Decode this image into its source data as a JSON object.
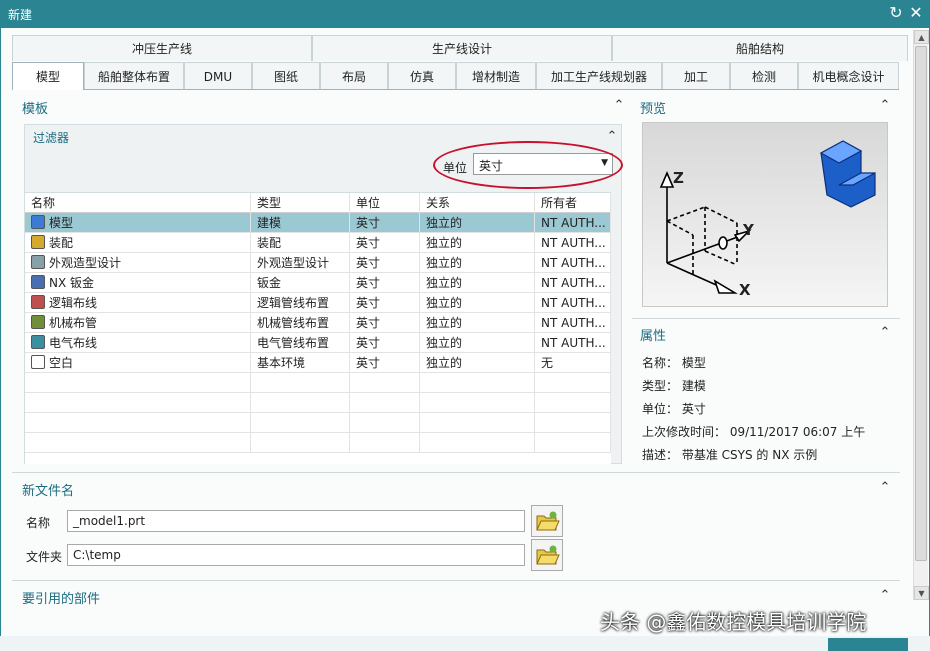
{
  "window": {
    "title": "新建"
  },
  "tabs_row1": [
    "冲压生产线",
    "生产线设计",
    "船舶结构"
  ],
  "tabs_row2": [
    "模型",
    "船舶整体布置",
    "DMU",
    "图纸",
    "布局",
    "仿真",
    "增材制造",
    "加工生产线规划器",
    "加工",
    "检测",
    "机电概念设计"
  ],
  "active_tab": "模型",
  "template_section": {
    "title": "模板"
  },
  "filter": {
    "title": "过滤器",
    "unit_label": "单位",
    "unit_value": "英寸"
  },
  "table": {
    "headers": [
      "名称",
      "类型",
      "单位",
      "关系",
      "所有者"
    ],
    "rows": [
      {
        "name": "模型",
        "type": "建模",
        "unit": "英寸",
        "relation": "独立的",
        "owner": "NT AUTH...",
        "icon": "model-icon",
        "icon_color": "#3a7bd5"
      },
      {
        "name": "装配",
        "type": "装配",
        "unit": "英寸",
        "relation": "独立的",
        "owner": "NT AUTH...",
        "icon": "assembly-icon",
        "icon_color": "#d5a92b"
      },
      {
        "name": "外观造型设计",
        "type": "外观造型设计",
        "unit": "英寸",
        "relation": "独立的",
        "owner": "NT AUTH...",
        "icon": "shape-design-icon",
        "icon_color": "#8aa0a8"
      },
      {
        "name": "NX 钣金",
        "type": "钣金",
        "unit": "英寸",
        "relation": "独立的",
        "owner": "NT AUTH...",
        "icon": "sheet-metal-icon",
        "icon_color": "#4a6fb0"
      },
      {
        "name": "逻辑布线",
        "type": "逻辑管线布置",
        "unit": "英寸",
        "relation": "独立的",
        "owner": "NT AUTH...",
        "icon": "logical-routing-icon",
        "icon_color": "#c0504d"
      },
      {
        "name": "机械布管",
        "type": "机械管线布置",
        "unit": "英寸",
        "relation": "独立的",
        "owner": "NT AUTH...",
        "icon": "mechanical-routing-icon",
        "icon_color": "#6f8f3a"
      },
      {
        "name": "电气布线",
        "type": "电气管线布置",
        "unit": "英寸",
        "relation": "独立的",
        "owner": "NT AUTH...",
        "icon": "electrical-routing-icon",
        "icon_color": "#3a8fa0"
      },
      {
        "name": "空白",
        "type": "基本环境",
        "unit": "英寸",
        "relation": "独立的",
        "owner": "无",
        "icon": "blank-icon",
        "icon_color": "#ffffff"
      }
    ]
  },
  "preview": {
    "title": "预览",
    "axis_x": "X",
    "axis_y": "Y",
    "axis_z": "Z"
  },
  "properties": {
    "title": "属性",
    "name_label": "名称：",
    "name_value": "模型",
    "type_label": "类型：",
    "type_value": "建模",
    "unit_label": "单位：",
    "unit_value": "英寸",
    "modified_label": "上次修改时间：",
    "modified_value": "09/11/2017 06:07 上午",
    "desc_label": "描述：",
    "desc_value": "带基准 CSYS 的 NX 示例"
  },
  "new_filename": {
    "title": "新文件名",
    "name_label": "名称",
    "name_value": "_model1.prt",
    "folder_label": "文件夹",
    "folder_value": "C:\\temp"
  },
  "referenced_parts": {
    "title": "要引用的部件"
  },
  "watermark": "头条 @鑫佑数控模具培训学院",
  "colors": {
    "titlebar": "#2a8492",
    "selection": "#9ac8d3",
    "section_title": "#1a6b80",
    "highlight_ellipse": "#c8102e"
  }
}
